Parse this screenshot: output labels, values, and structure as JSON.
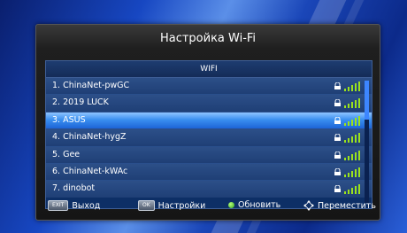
{
  "window": {
    "title": "Настройка Wi-Fi"
  },
  "list": {
    "header": "WIFI",
    "items": [
      {
        "label": "1.  ChinaNet-pwGC",
        "locked": true,
        "signal": 4
      },
      {
        "label": "2.  2019 LUCK",
        "locked": true,
        "signal": 4
      },
      {
        "label": "3.  ASUS",
        "locked": true,
        "signal": 4,
        "selected": true
      },
      {
        "label": "4.  ChinaNet-hygZ",
        "locked": true,
        "signal": 4
      },
      {
        "label": "5.  Gee",
        "locked": true,
        "signal": 4
      },
      {
        "label": "6.  ChinaNet-kWAc",
        "locked": true,
        "signal": 4
      },
      {
        "label": "7.  dinobot",
        "locked": true,
        "signal": 4
      }
    ]
  },
  "footer": {
    "exit_key": "EXIT",
    "exit_label": "Выход",
    "ok_key": "OK",
    "ok_label": "Настройки",
    "refresh_label": "Обновить",
    "move_label": "Переместить"
  },
  "colors": {
    "selection": "#3a8ff0",
    "signal": "#9be21d",
    "refresh_dot": "#2fa41f"
  },
  "icons": [
    "lock-icon",
    "wifi-signal-icon",
    "green-dot-icon",
    "navigation-arrows-icon"
  ]
}
